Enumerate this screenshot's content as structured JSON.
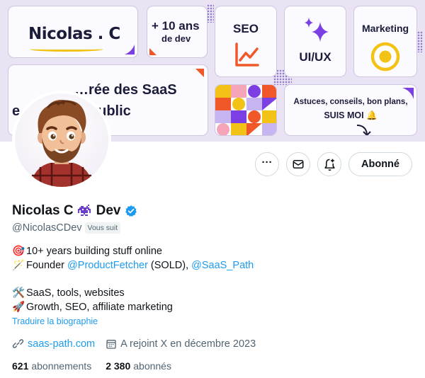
{
  "banner": {
    "name_tile": "Nicolas . C",
    "years_tile": {
      "line1": "+ 10 ans",
      "line2": "de dev"
    },
    "seo_tile": "SEO",
    "uiux_tile": "UI/UX",
    "marketing_tile": "Marketing",
    "saas_tile": {
      "line1": "…rée des SaaS",
      "line2": "e… tout en public"
    },
    "tips_tile": {
      "line1": "Astuces, conseils, bon plans,",
      "line2": "SUIS MOI 🔔"
    }
  },
  "actions": {
    "more_label": "···",
    "follow_label": "Abonné"
  },
  "profile": {
    "display_name_prefix": "Nicolas C",
    "display_name_suffix": "Dev",
    "handle": "@NicolasCDev",
    "follows_you": "Vous suit",
    "bio": {
      "line1_emoji": "🎯",
      "line1": "10+ years building stuff online",
      "line2_emoji": "🪄",
      "line2_a": "Founder ",
      "line2_link1": "@ProductFetcher",
      "line2_b": " (SOLD), ",
      "line2_link2": "@SaaS_Path",
      "line3_emoji": "🛠️",
      "line3": "SaaS, tools, websites",
      "line4_emoji": "🚀",
      "line4": "Growth, SEO, affiliate marketing"
    },
    "translate_bio": "Traduire la biographie",
    "website": "saas-path.com",
    "joined": "A rejoint X en décembre 2023",
    "following_count": "621",
    "following_label": "abonnements",
    "followers_count": "2 380",
    "followers_label": "abonnés"
  },
  "colors": {
    "link": "#1d9bf0",
    "verified": "#1d9bf0",
    "banner_bg": "#e9e3f4",
    "accent_orange": "#f0582a",
    "accent_purple": "#7b3fe4",
    "accent_yellow": "#f2c316"
  }
}
